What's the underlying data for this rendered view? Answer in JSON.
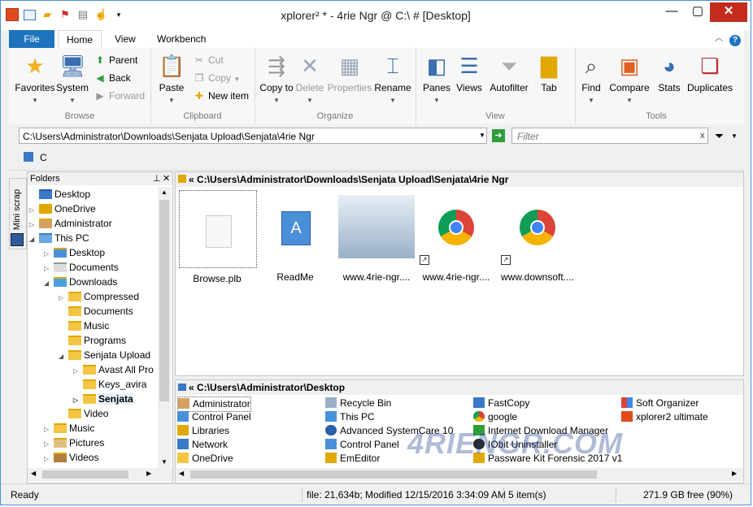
{
  "window": {
    "title": "xplorer² * - 4rie Ngr @ C:\\ # [Desktop]",
    "controls": {
      "minimize": "—",
      "maximize": "▢",
      "close": "✕"
    }
  },
  "ribbon": {
    "tabs": [
      "File",
      "Home",
      "View",
      "Workbench"
    ],
    "groups": {
      "browse": {
        "label": "Browse",
        "favorites": "Favorites",
        "system": "System",
        "parent": "Parent",
        "back": "Back",
        "forward": "Forward"
      },
      "clipboard": {
        "label": "Clipboard",
        "paste": "Paste",
        "cut": "Cut",
        "copy": "Copy",
        "new_item": "New item"
      },
      "organize": {
        "label": "Organize",
        "copy_to": "Copy to",
        "delete": "Delete",
        "properties": "Properties",
        "rename": "Rename"
      },
      "view": {
        "label": "View",
        "panes": "Panes",
        "views": "Views",
        "autofilter": "Autofilter",
        "tab": "Tab"
      },
      "tools": {
        "label": "Tools",
        "find": "Find",
        "compare": "Compare",
        "stats": "Stats",
        "duplicates": "Duplicates"
      }
    }
  },
  "address": {
    "path": "C:\\Users\\Administrator\\Downloads\\Senjata Upload\\Senjata\\4rie Ngr",
    "filter_placeholder": "Filter",
    "drive": "C"
  },
  "folders": {
    "header": "Folders",
    "side_tab": "Mini scrap",
    "tree": [
      {
        "label": "Desktop",
        "level": 0
      },
      {
        "label": "OneDrive",
        "level": 1
      },
      {
        "label": "Administrator",
        "level": 1
      },
      {
        "label": "This PC",
        "level": 1
      },
      {
        "label": "Desktop",
        "level": 2
      },
      {
        "label": "Documents",
        "level": 2
      },
      {
        "label": "Downloads",
        "level": 2
      },
      {
        "label": "Compressed",
        "level": 3
      },
      {
        "label": "Documents",
        "level": 3
      },
      {
        "label": "Music",
        "level": 3
      },
      {
        "label": "Programs",
        "level": 3
      },
      {
        "label": "Senjata Upload",
        "level": 3
      },
      {
        "label": "Avast All Pro",
        "level": 4
      },
      {
        "label": "Keys_avira",
        "level": 4
      },
      {
        "label": "Senjata",
        "level": 4
      },
      {
        "label": "Video",
        "level": 3
      },
      {
        "label": "Music",
        "level": 2
      },
      {
        "label": "Pictures",
        "level": 2
      },
      {
        "label": "Videos",
        "level": 2
      }
    ]
  },
  "top_pane": {
    "path": "« C:\\Users\\Administrator\\Downloads\\Senjata Upload\\Senjata\\4rie Ngr",
    "items": [
      "Browse.plb",
      "ReadMe",
      "www.4rie-ngr....",
      "www.4rie-ngr....",
      "www.downsoft...."
    ]
  },
  "bottom_pane": {
    "path": "« C:\\Users\\Administrator\\Desktop",
    "columns": [
      [
        "Administrator",
        "Control Panel",
        "Libraries",
        "Network",
        "OneDrive"
      ],
      [
        "Recycle Bin",
        "This PC",
        "Advanced SystemCare 10",
        "Control Panel",
        "EmEditor"
      ],
      [
        "FastCopy",
        "google",
        "Internet Download Manager",
        "IObit Uninstaller",
        "Passware Kit Forensic 2017 v1"
      ],
      [
        "Soft Organizer",
        "xplorer2 ultimate"
      ]
    ],
    "watermark": "4RIENGR.COM"
  },
  "status": {
    "ready": "Ready",
    "file_info": "file: 21,634b; Modified 12/15/2016 3:34:09 AM",
    "count": "5 item(s)",
    "free": "271.9 GB free (90%)"
  },
  "colors": {
    "accent": "#1e73be",
    "folder": "#f4c542",
    "close": "#c42b1c"
  }
}
